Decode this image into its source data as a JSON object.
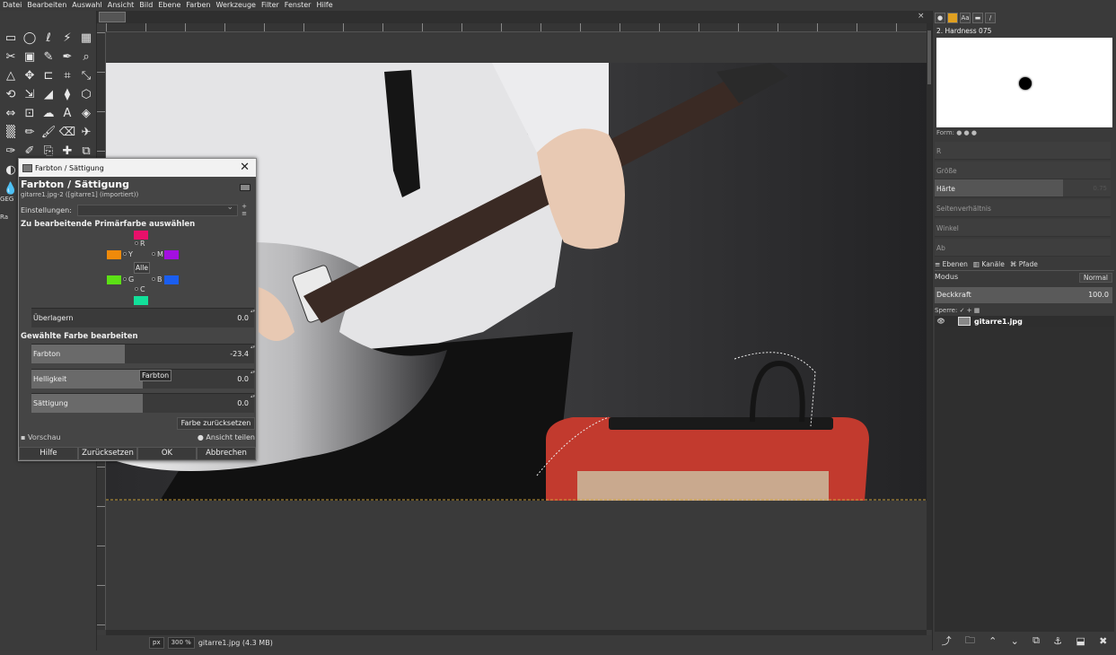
{
  "menu": [
    "Datei",
    "Bearbeiten",
    "Auswahl",
    "Ansicht",
    "Bild",
    "Ebene",
    "Farben",
    "Werkzeuge",
    "Filter",
    "Fenster",
    "Hilfe"
  ],
  "toolbox": {
    "tools": [
      {
        "icon": "rect-select-icon",
        "glyph": "▭"
      },
      {
        "icon": "ellipse-select-icon",
        "glyph": "◯"
      },
      {
        "icon": "lasso-icon",
        "glyph": "ℓ"
      },
      {
        "icon": "fuzzy-select-icon",
        "glyph": "⚡"
      },
      {
        "icon": "color-select-icon",
        "glyph": "▦"
      },
      {
        "icon": "scissors-icon",
        "glyph": "✂"
      },
      {
        "icon": "foreground-select-icon",
        "glyph": "▣"
      },
      {
        "icon": "paths-icon",
        "glyph": "✎"
      },
      {
        "icon": "color-picker-icon",
        "glyph": "✒"
      },
      {
        "icon": "zoom-icon",
        "glyph": "⌕"
      },
      {
        "icon": "measure-icon",
        "glyph": "△"
      },
      {
        "icon": "move-icon",
        "glyph": "✥"
      },
      {
        "icon": "align-icon",
        "glyph": "⊏"
      },
      {
        "icon": "crop-icon",
        "glyph": "⌗"
      },
      {
        "icon": "unified-transform-icon",
        "glyph": "⤡"
      },
      {
        "icon": "rotate-icon",
        "glyph": "⟲"
      },
      {
        "icon": "scale-icon",
        "glyph": "⇲"
      },
      {
        "icon": "shear-icon",
        "glyph": "◢"
      },
      {
        "icon": "perspective-icon",
        "glyph": "⧫"
      },
      {
        "icon": "3d-transform-icon",
        "glyph": "⬡"
      },
      {
        "icon": "flip-icon",
        "glyph": "⇔"
      },
      {
        "icon": "cage-icon",
        "glyph": "⊡"
      },
      {
        "icon": "warp-icon",
        "glyph": "☁"
      },
      {
        "icon": "text-icon",
        "glyph": "A"
      },
      {
        "icon": "bucket-fill-icon",
        "glyph": "◈"
      },
      {
        "icon": "gradient-icon",
        "glyph": "▒"
      },
      {
        "icon": "pencil-icon",
        "glyph": "✏"
      },
      {
        "icon": "paintbrush-icon",
        "glyph": "🖌"
      },
      {
        "icon": "eraser-icon",
        "glyph": "⌫"
      },
      {
        "icon": "airbrush-icon",
        "glyph": "✈"
      },
      {
        "icon": "ink-icon",
        "glyph": "✑"
      },
      {
        "icon": "mypaint-brush-icon",
        "glyph": "✐"
      },
      {
        "icon": "clone-icon",
        "glyph": "⎘"
      },
      {
        "icon": "heal-icon",
        "glyph": "✚"
      },
      {
        "icon": "perspective-clone-icon",
        "glyph": "⧉"
      },
      {
        "icon": "blur-icon",
        "glyph": "◐"
      },
      {
        "icon": "smudge-icon",
        "glyph": "☝"
      },
      {
        "icon": "dodge-burn-icon",
        "glyph": "◑"
      },
      {
        "icon": "color-swatch-icon",
        "glyph": "■"
      },
      {
        "icon": "fg-bg-icon",
        "glyph": "◼"
      },
      {
        "icon": "drop-icon",
        "glyph": "💧"
      }
    ],
    "edge_text": [
      "GEG",
      "Ra"
    ]
  },
  "image_tab": {
    "close_glyph": "×"
  },
  "statusbar": {
    "unit": "px",
    "zoom": "300 %",
    "file_info": "gitarre1.jpg (4.3 MB)"
  },
  "dialog": {
    "window_title": "Farbton / Sättigung",
    "heading": "Farbton / Sättigung",
    "subtitle": "gitarre1.jpg-2 ([gitarre1] (importiert))",
    "close_glyph": "✕",
    "presets_label": "Einstellungen:",
    "presets_value": "",
    "presets_buttons": "+ ≡",
    "primary_section": "Zu bearbeitende Primärfarbe auswählen",
    "colors": {
      "R": {
        "label": "R",
        "hex": "#e8106a"
      },
      "Y": {
        "label": "Y",
        "hex": "#f08a0a"
      },
      "M": {
        "label": "M",
        "hex": "#a30fe0"
      },
      "G": {
        "label": "G",
        "hex": "#5ce015"
      },
      "B": {
        "label": "B",
        "hex": "#1a5ef0"
      },
      "C": {
        "label": "C",
        "hex": "#12e09a"
      }
    },
    "alle_label": "Alle",
    "overlap_label": "Überlagern",
    "overlap_value": "0.0",
    "edit_section": "Gewählte Farbe bearbeiten",
    "hue_label": "Farbton",
    "hue_value": "-23.4",
    "hue_fraction": 0.42,
    "lightness_label": "Helligkeit",
    "lightness_value": "0.0",
    "saturation_label": "Sättigung",
    "saturation_value": "0.0",
    "tooltip": "Farbton",
    "reset_color": "Farbe zurücksetzen",
    "preview_label": "Vorschau",
    "split_view": "Ansicht teilen",
    "buttons": {
      "help": "Hilfe",
      "reset": "Zurücksetzen",
      "ok": "OK",
      "cancel": "Abbrechen"
    }
  },
  "dock": {
    "brush_name": "2. Hardness 075",
    "forms_label": "Form: ● ● ●",
    "dynamics": [
      {
        "label": "R",
        "value": "",
        "active": false
      },
      {
        "label": "Größe",
        "value": "",
        "active": false
      },
      {
        "label": "Härte",
        "value": "0.75",
        "active": true
      },
      {
        "label": "Seitenverhältnis",
        "value": "",
        "active": false
      },
      {
        "label": "Winkel",
        "value": "",
        "active": false
      },
      {
        "label": "Ab",
        "value": "",
        "active": false
      }
    ],
    "layers_tabs": [
      "Ebenen",
      "Kanäle",
      "Pfade"
    ],
    "mode_label": "Modus",
    "mode_value": "Normal",
    "opacity_label": "Deckkraft",
    "opacity_value": "100.0",
    "lock_label": "Sperre: ✓ + ▦",
    "layer_name": "gitarre1.jpg",
    "layer_buttons": [
      "⤴",
      "🗀",
      "⌃",
      "⌄",
      "⧉",
      "⚓",
      "⬓",
      "✖"
    ]
  }
}
